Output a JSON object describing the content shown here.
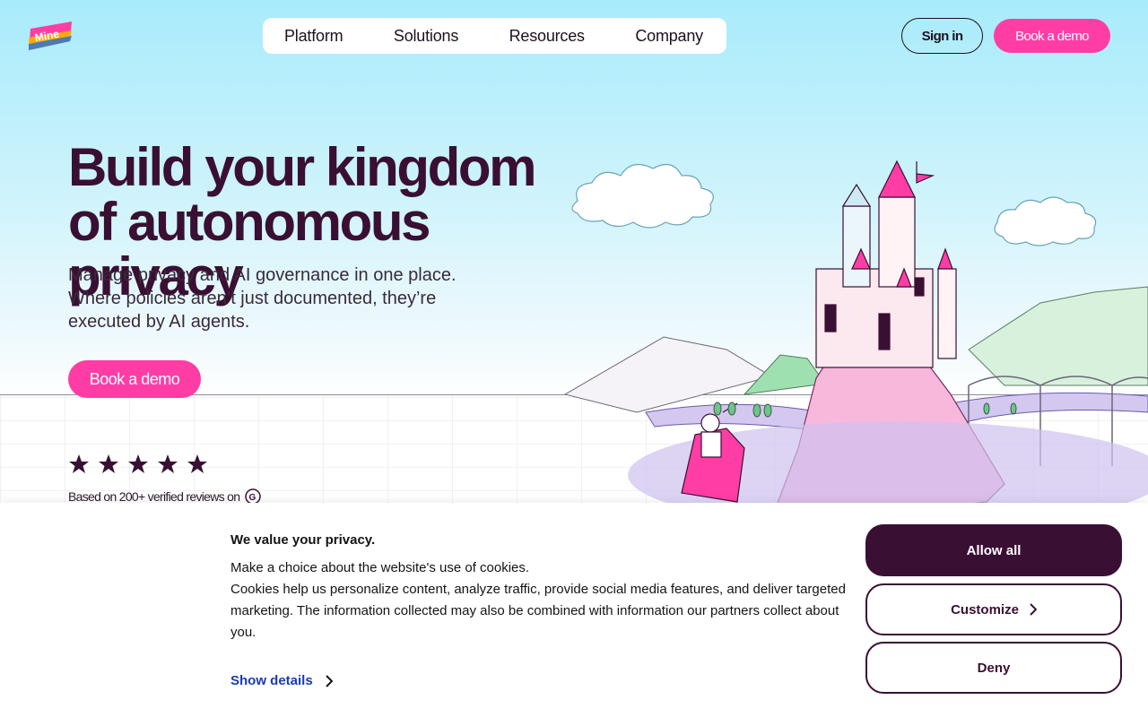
{
  "brand": {
    "logo_text": "Mine",
    "accent": "#ff3da5",
    "dark": "#3a0f34"
  },
  "nav": {
    "items": [
      {
        "label": "Platform"
      },
      {
        "label": "Solutions"
      },
      {
        "label": "Resources"
      },
      {
        "label": "Company"
      }
    ],
    "sign_in": "Sign in",
    "book_demo": "Book a demo"
  },
  "hero": {
    "headline_line1": "Build your kingdom",
    "headline_line2": "of autonomous privacy",
    "subtitle": "Manage privacy and AI governance in one place. Where policies aren’t just documented, they’re executed by AI agents.",
    "cta": "Book a demo",
    "rating_stars": 5,
    "reviews_text": "Based on 200+ verified reviews on",
    "reviews_icon": "g2-icon"
  },
  "cookie": {
    "title": "We value your privacy.",
    "line1": "Make a choice about the website's use of cookies.",
    "line2": "Cookies help us personalize content, analyze traffic, provide social media features, and deliver targeted marketing. The information collected may also be combined with information our partners collect about you.",
    "show_details": "Show details",
    "allow_all": "Allow all",
    "customize": "Customize",
    "deny": "Deny"
  }
}
